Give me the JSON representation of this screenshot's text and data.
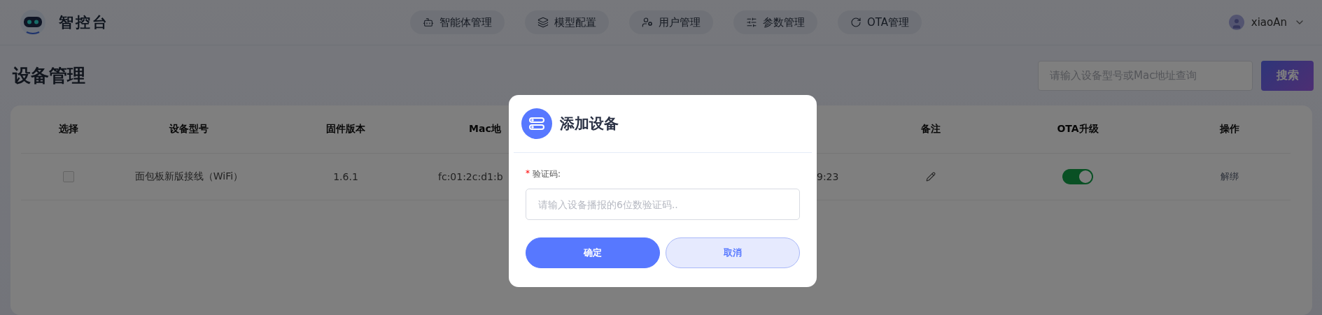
{
  "header": {
    "logo_text": "智控台",
    "nav": [
      {
        "label": "智能体管理"
      },
      {
        "label": "模型配置"
      },
      {
        "label": "用户管理"
      },
      {
        "label": "参数管理"
      },
      {
        "label": "OTA管理"
      }
    ],
    "user": "xiaoAn"
  },
  "page": {
    "title": "设备管理",
    "search": {
      "placeholder": "请输入设备型号或Mac地址查询"
    },
    "search_button": "搜索"
  },
  "table": {
    "columns": [
      {
        "label": "选择",
        "kind": "plain"
      },
      {
        "label": "设备型号",
        "kind": "plain"
      },
      {
        "label": "固件版本",
        "kind": "plain"
      },
      {
        "label": "Mac地",
        "kind": "cut"
      },
      {
        "kind": "hidden"
      },
      {
        "kind": "hidden"
      },
      {
        "label": "备注",
        "kind": "plain"
      },
      {
        "label": "OTA升级",
        "kind": "plain"
      },
      {
        "label": "操作",
        "kind": "plain"
      }
    ],
    "rows": [
      {
        "checked": false,
        "model": "面包板新版接线（WiFi）",
        "firmware": "1.6.1",
        "mac": "fc:01:2c:d1:b",
        "time": "9:23",
        "ota_on": true,
        "action": "解绑"
      }
    ]
  },
  "dialog": {
    "title": "添加设备",
    "field": {
      "label": "验证码:",
      "required": true,
      "required_mark": "*",
      "placeholder": "请输入设备播报的6位数验证码.."
    },
    "buttons": [
      {
        "label": "确定",
        "kind": "primary"
      },
      {
        "label": "取消",
        "kind": "secondary"
      }
    ]
  }
}
